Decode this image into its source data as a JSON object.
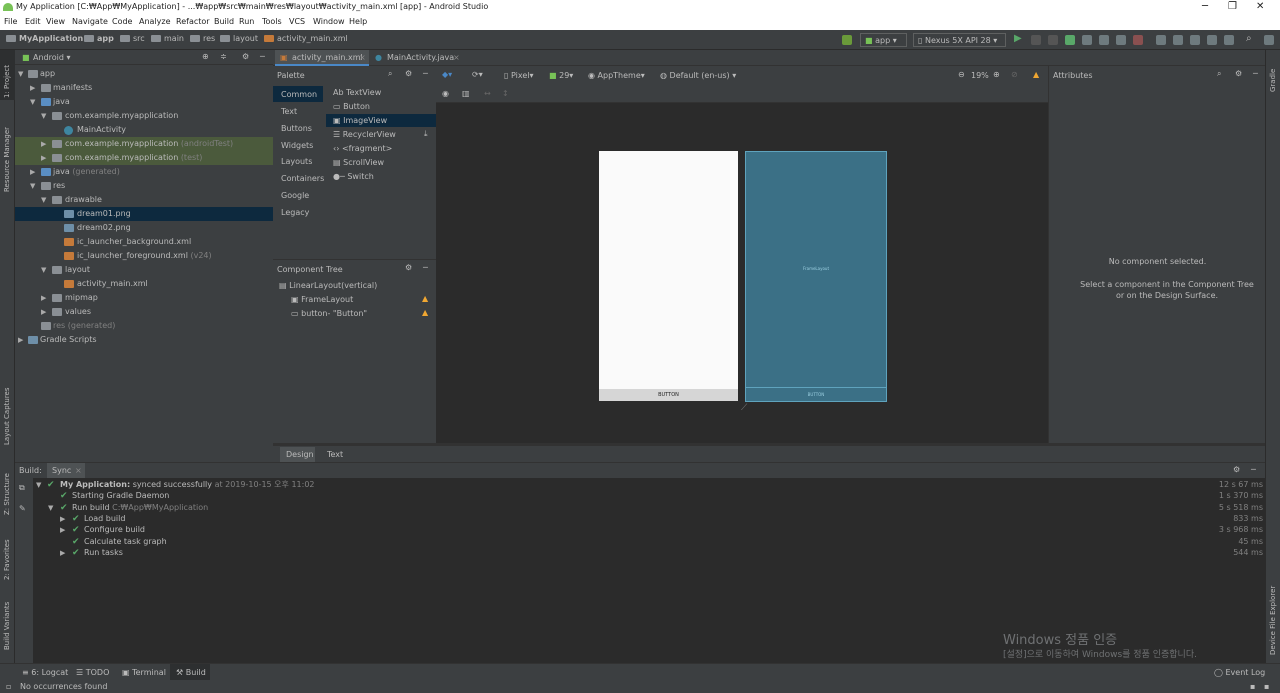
{
  "window": {
    "title": "My Application [C:₩App₩MyApplication] - ...₩app₩src₩main₩res₩layout₩activity_main.xml [app] - Android Studio"
  },
  "menu": [
    "File",
    "Edit",
    "View",
    "Navigate",
    "Code",
    "Analyze",
    "Refactor",
    "Build",
    "Run",
    "Tools",
    "VCS",
    "Window",
    "Help"
  ],
  "breadcrumbs": [
    "MyApplication",
    "app",
    "src",
    "main",
    "res",
    "layout",
    "activity_main.xml"
  ],
  "toolbar": {
    "config": "app",
    "device": "Nexus 5X API 28"
  },
  "left_strip": [
    "1: Project",
    "Resource Manager",
    "Layout Captures",
    "Z: Structure",
    "2: Favorites",
    "Build Variants"
  ],
  "right_strip": [
    "Gradle",
    "Device File Explorer"
  ],
  "project": {
    "view": "Android",
    "tree": [
      {
        "label": "app",
        "extra": ""
      },
      {
        "label": "manifests",
        "extra": ""
      },
      {
        "label": "java",
        "extra": ""
      },
      {
        "label": "com.example.myapplication",
        "extra": ""
      },
      {
        "label": "MainActivity",
        "extra": ""
      },
      {
        "label": "com.example.myapplication",
        "extra": "(androidTest)"
      },
      {
        "label": "com.example.myapplication",
        "extra": "(test)"
      },
      {
        "label": "java",
        "extra": "(generated)"
      },
      {
        "label": "res",
        "extra": ""
      },
      {
        "label": "drawable",
        "extra": ""
      },
      {
        "label": "dream01.png",
        "extra": ""
      },
      {
        "label": "dream02.png",
        "extra": ""
      },
      {
        "label": "ic_launcher_background.xml",
        "extra": ""
      },
      {
        "label": "ic_launcher_foreground.xml",
        "extra": "(v24)"
      },
      {
        "label": "layout",
        "extra": ""
      },
      {
        "label": "activity_main.xml",
        "extra": ""
      },
      {
        "label": "mipmap",
        "extra": ""
      },
      {
        "label": "values",
        "extra": ""
      },
      {
        "label": "res",
        "extra": "(generated)"
      },
      {
        "label": "Gradle Scripts",
        "extra": ""
      }
    ]
  },
  "editor_tabs": [
    "activity_main.xml",
    "MainActivity.java"
  ],
  "palette": {
    "title": "Palette",
    "categories": [
      "Common",
      "Text",
      "Buttons",
      "Widgets",
      "Layouts",
      "Containers",
      "Google",
      "Legacy"
    ],
    "items": [
      "Ab TextView",
      "Button",
      "ImageView",
      "RecyclerView",
      "<fragment>",
      "ScrollView",
      "Switch"
    ]
  },
  "component_tree": {
    "title": "Component Tree",
    "items": [
      "LinearLayout(vertical)",
      "FrameLayout",
      "button- \"Button\""
    ]
  },
  "design_toolbar": {
    "device": "Pixel",
    "api": "29",
    "theme": "AppTheme",
    "locale": "Default (en-us)",
    "zoom": "19%"
  },
  "canvas": {
    "button_label": "BUTTON",
    "blueprint_label": "FrameLayout",
    "blueprint_button": "BUTTON"
  },
  "attributes": {
    "title": "Attributes",
    "empty": "No component selected.",
    "hint": "Select a component in the Component Tree or on the Design Surface."
  },
  "design_tabs": [
    "Design",
    "Text"
  ],
  "build": {
    "tabs": [
      "Build:",
      "Sync"
    ],
    "lines": [
      {
        "text": "My Application:",
        "rest": "synced successfully",
        "time_note": "at 2019-10-15 오후 11:02",
        "duration": "12 s 67 ms",
        "indent": 0
      },
      {
        "text": "Starting Gradle Daemon",
        "rest": "",
        "time_note": "",
        "duration": "1 s 370 ms",
        "indent": 1
      },
      {
        "text": "Run build",
        "rest": "",
        "time_note": "C:₩App₩MyApplication",
        "duration": "5 s 518 ms",
        "indent": 1
      },
      {
        "text": "Load build",
        "rest": "",
        "time_note": "",
        "duration": "833 ms",
        "indent": 2
      },
      {
        "text": "Configure build",
        "rest": "",
        "time_note": "",
        "duration": "3 s 968 ms",
        "indent": 2
      },
      {
        "text": "Calculate task graph",
        "rest": "",
        "time_note": "",
        "duration": "45 ms",
        "indent": 2
      },
      {
        "text": "Run tasks",
        "rest": "",
        "time_note": "",
        "duration": "544 ms",
        "indent": 2
      }
    ]
  },
  "watermark": {
    "line1": "Windows 정품 인증",
    "line2": "[설정]으로 이동하여 Windows를 정품 인증합니다."
  },
  "toolwindows": [
    "6: Logcat",
    "TODO",
    "Terminal",
    "Build"
  ],
  "event_log": "Event Log",
  "status": "No occurrences found",
  "colors": {
    "selection": "#0d293e",
    "test_highlight": "#4b5a3c",
    "blueprint": "#3b7086",
    "check": "#59a869",
    "warning": "#f0a732"
  }
}
